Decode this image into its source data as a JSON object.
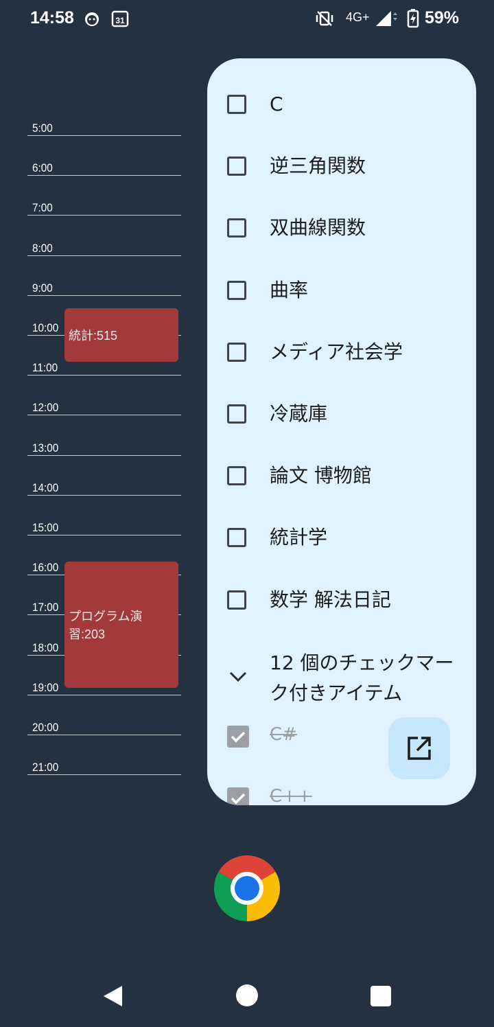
{
  "status_bar": {
    "time": "14:58",
    "network": "4G+",
    "battery": "59%",
    "icons": [
      "cat-notification-icon",
      "calendar-31-icon",
      "vibrate-off-icon",
      "signal-icon",
      "battery-charging-icon"
    ],
    "calendar_day": "31"
  },
  "schedule": {
    "hours": [
      "5:00",
      "6:00",
      "7:00",
      "8:00",
      "9:00",
      "10:00",
      "11:00",
      "12:00",
      "13:00",
      "14:00",
      "15:00",
      "16:00",
      "17:00",
      "18:00",
      "19:00",
      "20:00",
      "21:00"
    ],
    "events": [
      {
        "label": "統計:515",
        "start": "9:20",
        "end": "10:40"
      },
      {
        "label": "プログラム演習:203",
        "start": "15:40",
        "end": "18:50"
      }
    ],
    "event_color": "#a23a3c"
  },
  "todo": {
    "items": [
      {
        "label": "C",
        "checked": false
      },
      {
        "label": "逆三角関数",
        "checked": false
      },
      {
        "label": "双曲線関数",
        "checked": false
      },
      {
        "label": "曲率",
        "checked": false
      },
      {
        "label": "メディア社会学",
        "checked": false
      },
      {
        "label": "冷蔵庫",
        "checked": false
      },
      {
        "label": "論文 博物館",
        "checked": false
      },
      {
        "label": "統計学",
        "checked": false
      },
      {
        "label": "数学 解法日記",
        "checked": false
      }
    ],
    "completed_header": "12 個のチェックマーク付きアイテム",
    "completed_items": [
      {
        "label": "C#",
        "checked": true
      },
      {
        "label": "C++",
        "checked": true
      }
    ],
    "fab_icon": "open-in-new-icon"
  },
  "dock": {
    "app_icon": "chrome-icon"
  },
  "nav": {
    "back": "back-icon",
    "home": "home-icon",
    "recents": "recents-icon"
  }
}
